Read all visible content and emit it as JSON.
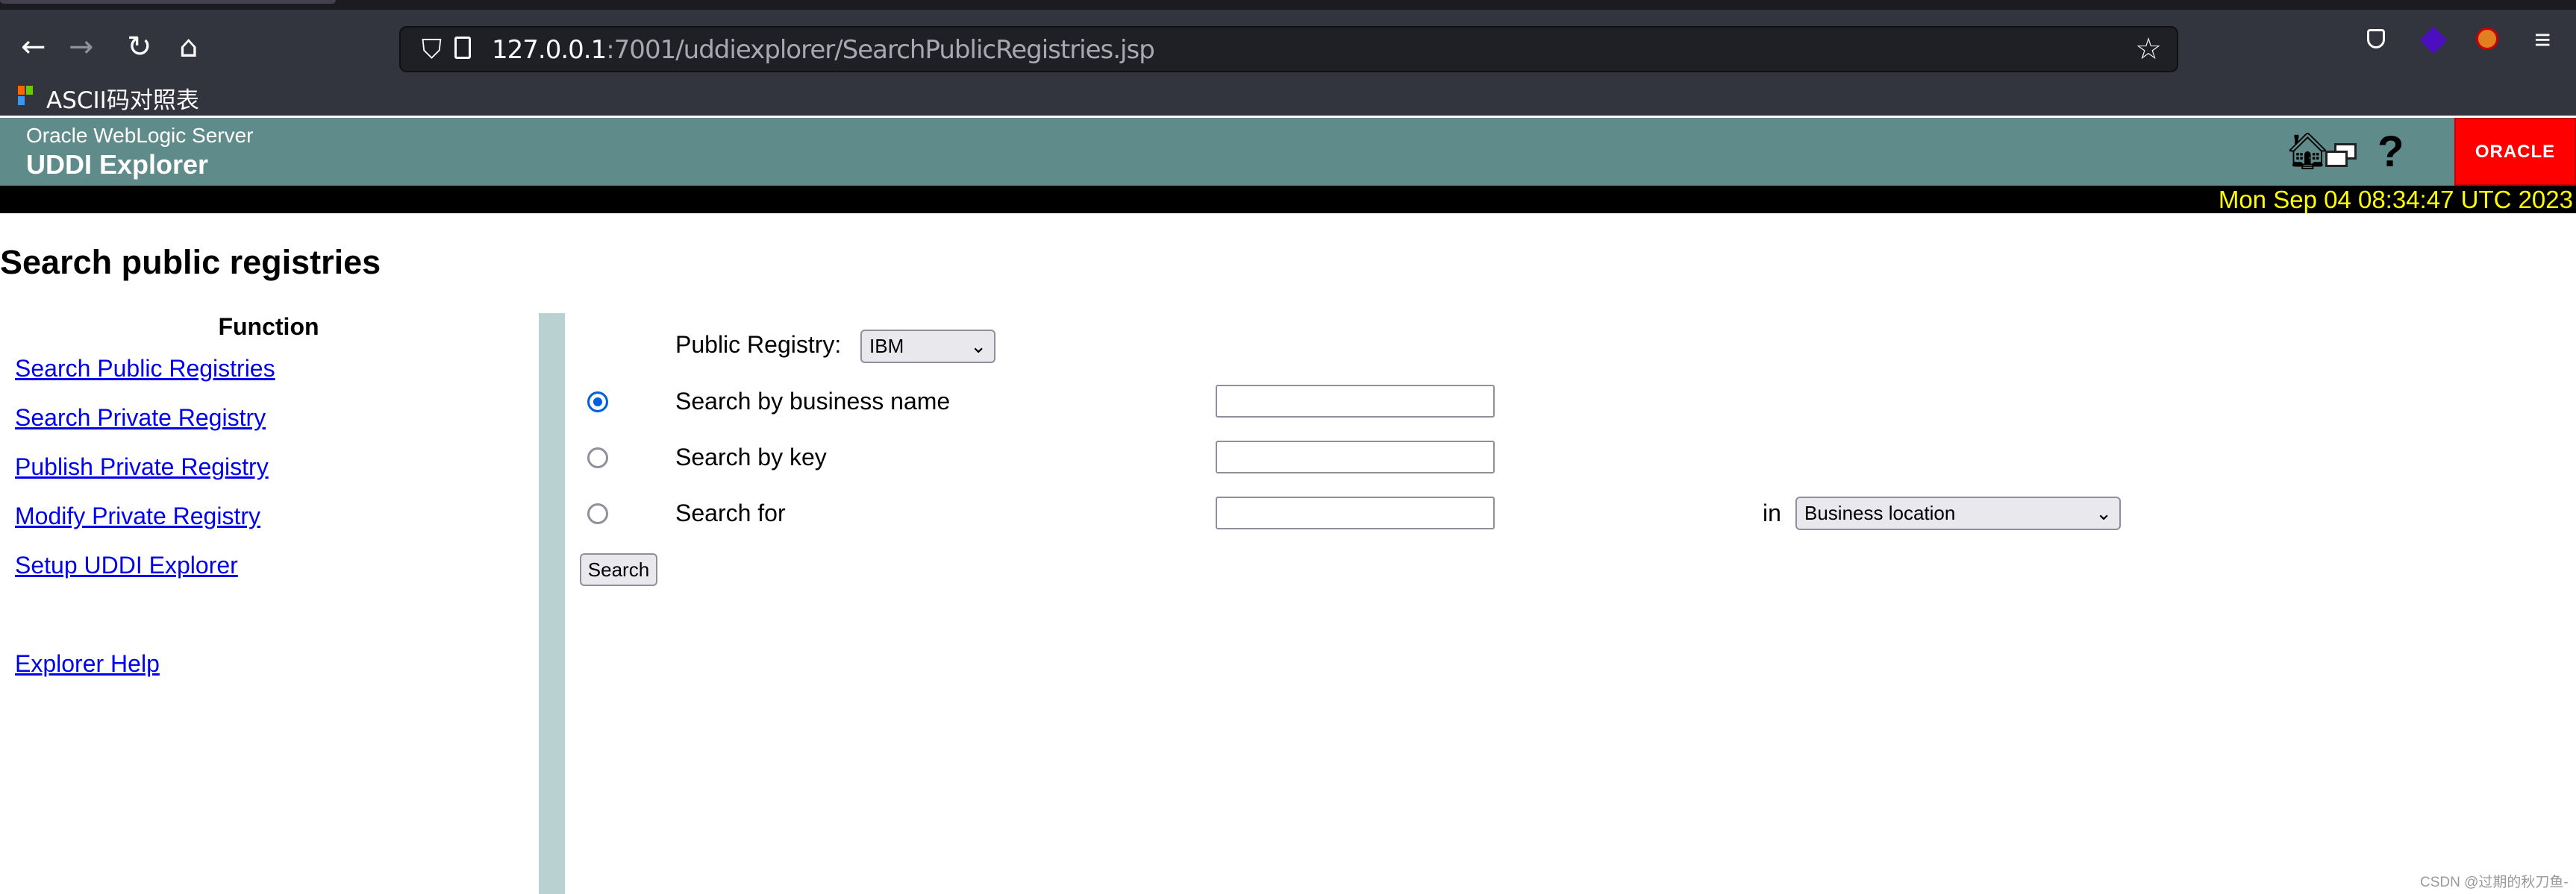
{
  "browser": {
    "url_host": "127.0.0.1",
    "url_rest": ":7001/uddiexplorer/SearchPublicRegistries.jsp",
    "bookmark": "ASCII码对照表",
    "icons": [
      "back-icon",
      "forward-icon",
      "reload-icon",
      "home-icon",
      "shield-icon",
      "page-icon",
      "star-icon",
      "pocket-icon",
      "extension-icon",
      "fox-extension-icon",
      "menu-icon"
    ]
  },
  "header": {
    "subtitle": "Oracle WebLogic Server",
    "title": "UDDI Explorer",
    "logo": "ORACLE",
    "date": "Mon Sep 04 08:34:47 UTC 2023",
    "colors": {
      "header": "#5f8c8a",
      "date": "#ffff00",
      "logo": "#ff0000"
    }
  },
  "page": {
    "title": "Search public registries"
  },
  "sidebar": {
    "heading": "Function",
    "items": [
      {
        "label": "Search Public Registries"
      },
      {
        "label": "Search Private Registry"
      },
      {
        "label": "Publish Private Registry"
      },
      {
        "label": "Modify Private Registry"
      },
      {
        "label": "Setup UDDI Explorer"
      },
      {
        "label": "Explorer Help"
      }
    ]
  },
  "form": {
    "registry_label": "Public Registry:",
    "registry_value": "IBM",
    "options": [
      {
        "label": "Search by business name",
        "selected": true,
        "value": ""
      },
      {
        "label": "Search by key",
        "selected": false,
        "value": ""
      },
      {
        "label": "Search for",
        "selected": false,
        "value": ""
      }
    ],
    "in_label": "in",
    "in_value": "Business location",
    "search_label": "Search"
  },
  "watermark": "CSDN @过期的秋刀鱼-"
}
